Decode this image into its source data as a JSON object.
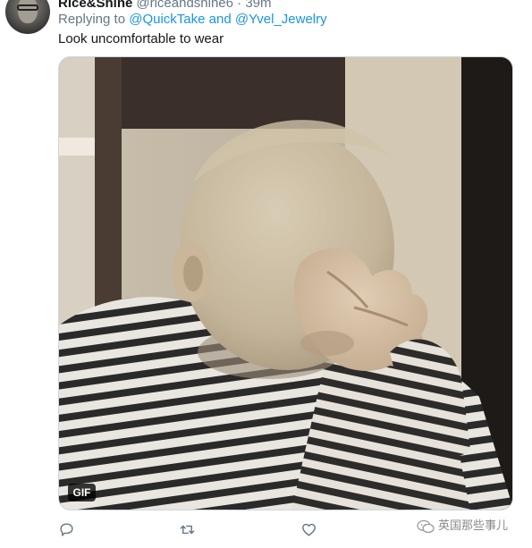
{
  "tweet": {
    "display_name": "Rice&Shine",
    "handle_time": "@riceandshine6 · 39m",
    "replying_prefix": "Replying to ",
    "reply_to": [
      "@QuickTake",
      "@Yvel_Jewelry"
    ],
    "reply_joiner": " and ",
    "text": "Look uncomfortable to wear"
  },
  "media": {
    "badge": "GIF"
  },
  "actions": {
    "icons": [
      "reply-icon",
      "retweet-icon",
      "like-icon"
    ]
  },
  "watermark": {
    "text": "英国那些事儿"
  },
  "colors": {
    "link": "#1b95e0",
    "secondary_text": "#657786",
    "primary_text": "#14171a",
    "border": "#ccd6dd"
  }
}
